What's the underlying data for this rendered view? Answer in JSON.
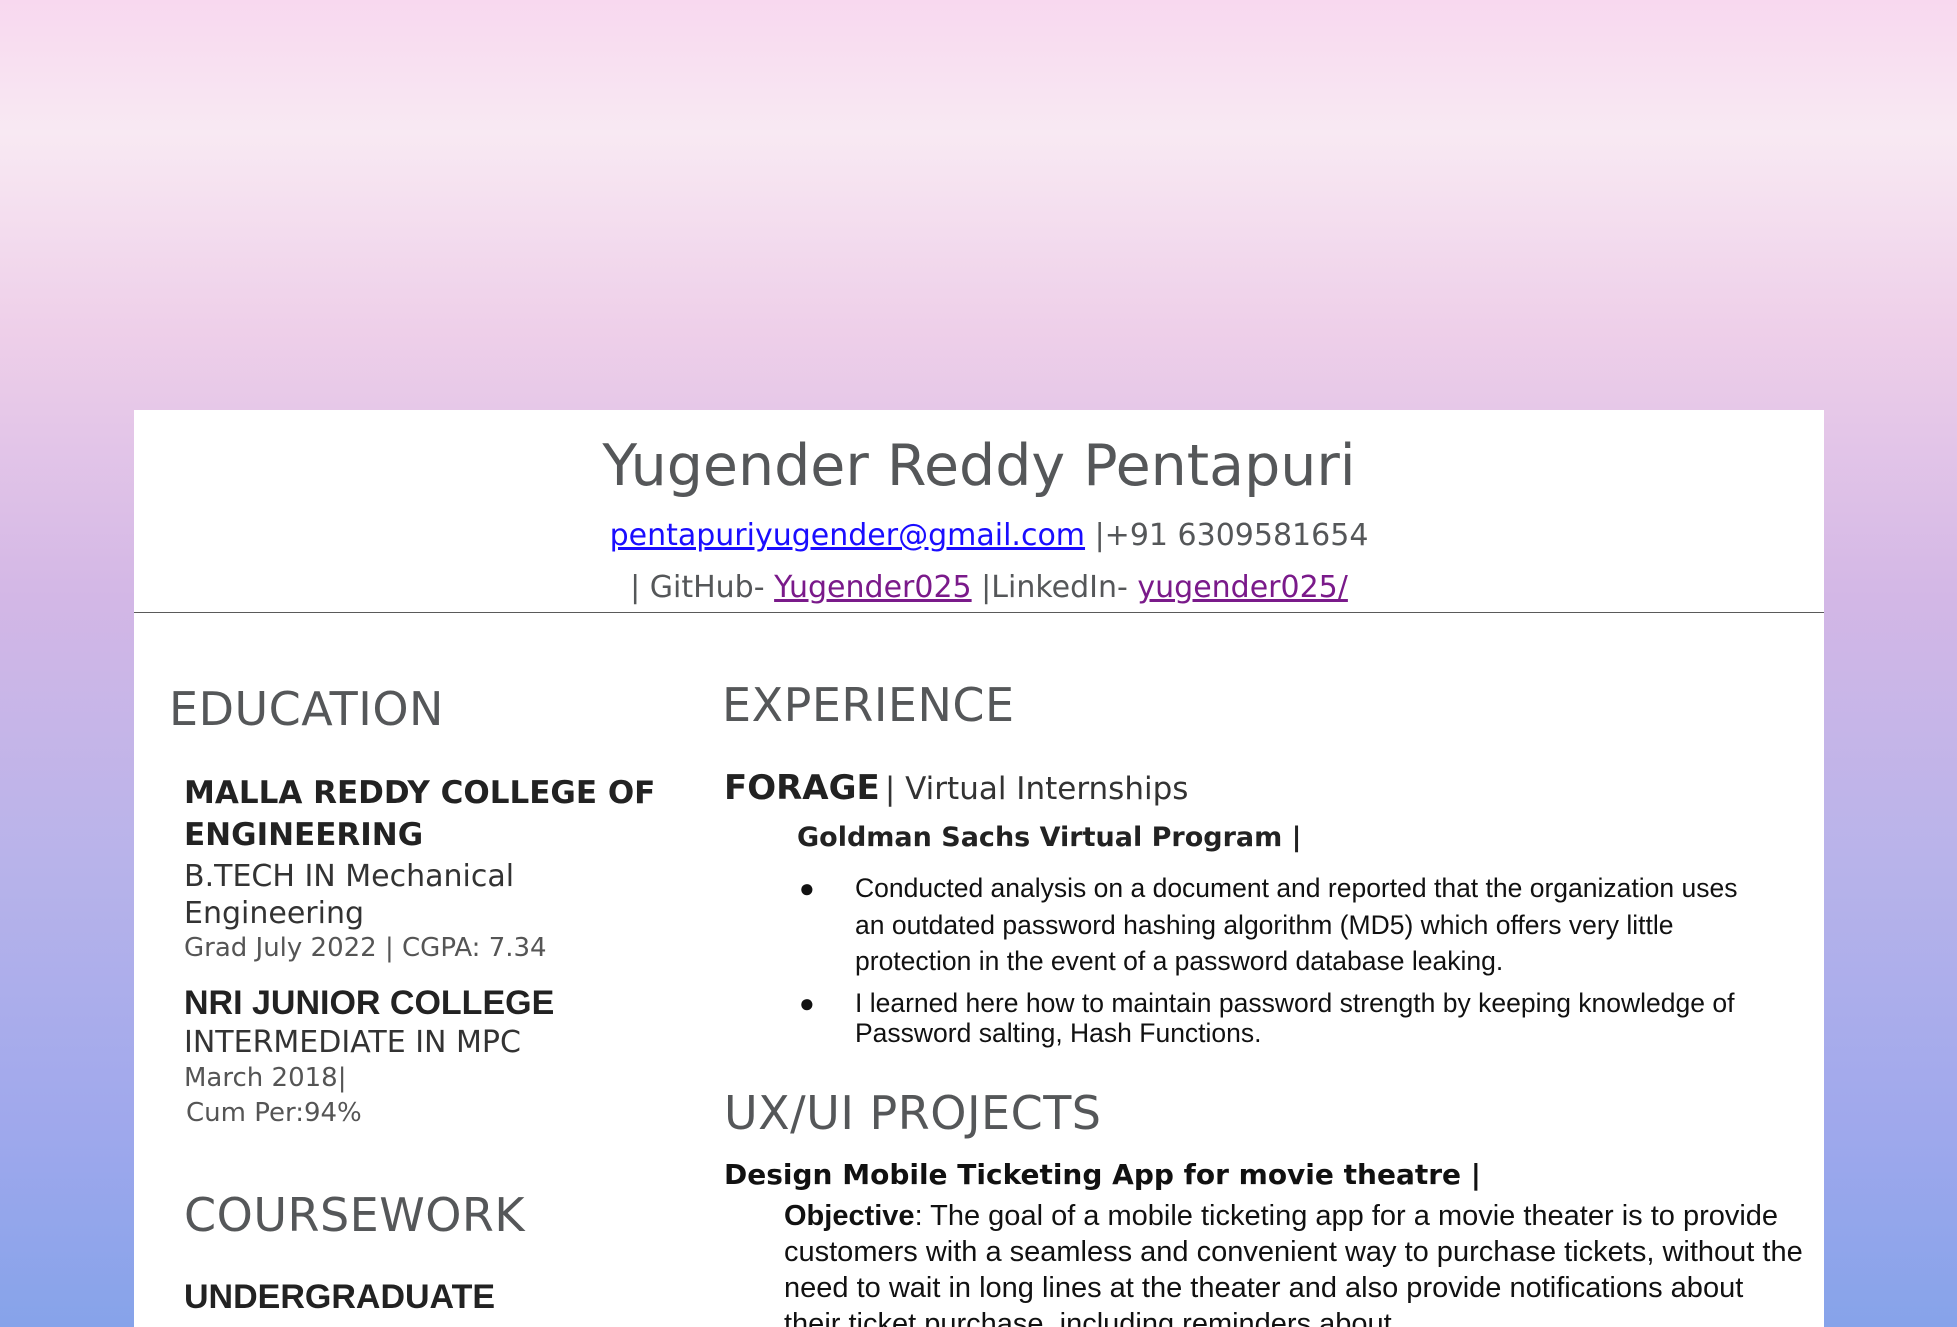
{
  "header": {
    "name": "Yugender Reddy Pentapuri",
    "email": "pentapuriyugender@gmail.com",
    "phone": "|+91 6309581654",
    "github_prefix": "| GitHub-",
    "github_link": "Yugender025",
    "linkedin_prefix": "|LinkedIn-",
    "linkedin_link": "yugender025/"
  },
  "education": {
    "title": "EDUCATION",
    "schools": [
      {
        "name_line1": "MALLA REDDY COLLEGE OF",
        "name_line2": "ENGINEERING",
        "degree_line1": "B.TECH IN Mechanical",
        "degree_line2": "Engineering",
        "meta_line1": "Grad July 2022 | CGPA: 7.34"
      },
      {
        "name_line1": "NRI JUNIOR COLLEGE",
        "degree_line1": "INTERMEDIATE IN MPC",
        "meta_line1": "March 2018|",
        "meta_line2": "Cum Per:94%"
      }
    ]
  },
  "coursework": {
    "title": "COURSEWORK",
    "subtitle": "UNDERGRADUATE"
  },
  "experience": {
    "title": "EXPERIENCE",
    "company": "FORAGE",
    "company_sub": " |  Virtual  Internships",
    "program": "Goldman Sachs Virtual Program |",
    "bullets": [
      "Conducted analysis on a document and reported that the organization uses an outdated password hashing algorithm (MD5) which offers very little protection in the event of a password database leaking.",
      "I learned here how to maintain password strength by keeping knowledge of Password salting, Hash Functions."
    ]
  },
  "projects": {
    "title": "UX/UI PROJECTS",
    "project_title": "Design Mobile Ticketing App for movie theatre |",
    "objective_label": "Objective",
    "objective_text": ": The goal of a mobile ticketing app for a movie theater is to provide customers with a seamless and convenient way to purchase tickets, without the need to wait in long lines at the theater and also provide notifications about their ticket purchase, including reminders about"
  }
}
